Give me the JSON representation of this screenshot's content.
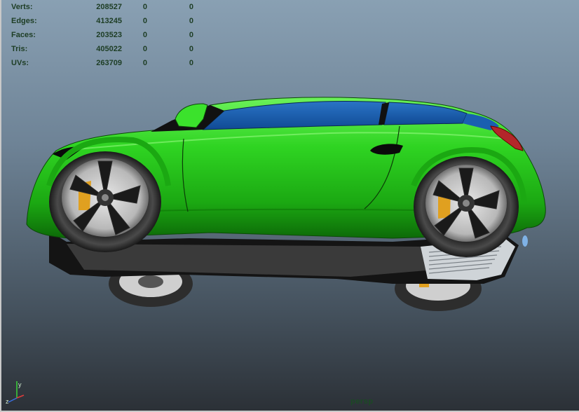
{
  "hud": {
    "rows": [
      {
        "label": "Verts:",
        "v1": "208527",
        "v2": "0",
        "v3": "0"
      },
      {
        "label": "Edges:",
        "v1": "413245",
        "v2": "0",
        "v3": "0"
      },
      {
        "label": "Faces:",
        "v1": "203523",
        "v2": "0",
        "v3": "0"
      },
      {
        "label": "Tris:",
        "v1": "405022",
        "v2": "0",
        "v3": "0"
      },
      {
        "label": "UVs:",
        "v1": "263709",
        "v2": "0",
        "v3": "0"
      }
    ]
  },
  "axis": {
    "y": "y",
    "z": "z"
  },
  "camera": {
    "name": "persp"
  },
  "colors": {
    "car_body": "#22c41a",
    "glass": "#1a5fb0",
    "hud_text": "#1d3d24"
  }
}
